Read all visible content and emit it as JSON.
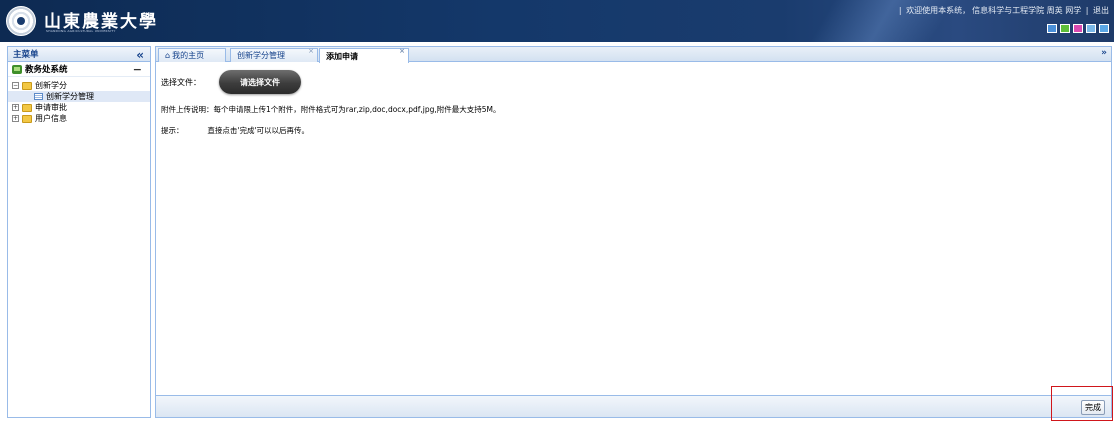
{
  "header": {
    "school_name": "山東農業大學",
    "school_name_en": "SHANDONG AGRICULTURAL UNIVERSITY",
    "separator_1": "|",
    "welcome_text": "欢迎使用本系统，",
    "user_info": "信息科学与工程学院 周英 网学",
    "separator_2": "|",
    "logout_label": "退出",
    "theme_swatches": [
      "#4a90d9",
      "#5fbf3a",
      "#d94ab0",
      "#7ab8e8",
      "#5aa7e6"
    ]
  },
  "sidebar": {
    "title": "主菜单",
    "collapse_icon": "double-chevron-left-icon",
    "system_name": "教务处系统",
    "system_toggle": "−",
    "tree": [
      {
        "label": "创新学分",
        "expander": "⊟"
      },
      {
        "label": "创新学分管理"
      },
      {
        "label": "申请审批",
        "expander": "⊞"
      },
      {
        "label": "用户信息",
        "expander": "⊞"
      }
    ]
  },
  "tabs": [
    {
      "icon": "⌂",
      "label": "我的主页",
      "close": ""
    },
    {
      "label": "创新学分管理",
      "close": "×"
    },
    {
      "label": "添加申请",
      "close": "×"
    }
  ],
  "tabbar_menu": "»",
  "form": {
    "file_label": "选择文件：",
    "choose_button": "请选择文件",
    "description": "附件上传说明：每个申请限上传1个附件，附件格式可为rar,zip,doc,docx,pdf,jpg,附件最大支持5M。",
    "hint_label": "提示：",
    "hint_text": "直接点击'完成'可以以后再传。"
  },
  "footer": {
    "finish_button": "完成"
  },
  "colors": {
    "header_bg": "#14386a",
    "panel_border": "#99bbe8",
    "highlight": "#d0161b"
  }
}
